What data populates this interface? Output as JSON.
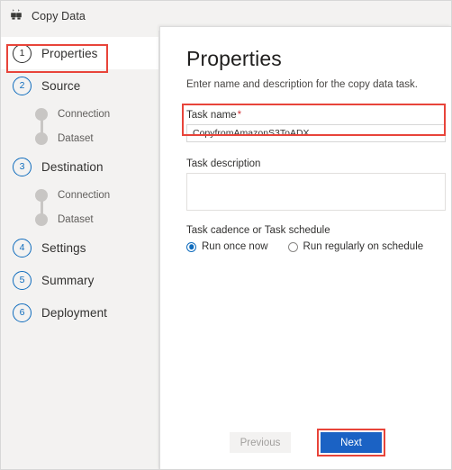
{
  "window": {
    "title": "Copy Data",
    "icon": "copy-data-icon"
  },
  "colors": {
    "accent_blue": "#0f6cbd",
    "primary_button": "#1b62c4",
    "annotation_red": "#e8443a",
    "required_red": "#d13438",
    "rail_background": "#f3f2f1",
    "active_step": "#2b2b2b"
  },
  "sidebar": {
    "steps": [
      {
        "number": "1",
        "label": "Properties",
        "active": true,
        "substeps": []
      },
      {
        "number": "2",
        "label": "Source",
        "active": false,
        "substeps": [
          "Connection",
          "Dataset"
        ]
      },
      {
        "number": "3",
        "label": "Destination",
        "active": false,
        "substeps": [
          "Connection",
          "Dataset"
        ]
      },
      {
        "number": "4",
        "label": "Settings",
        "active": false,
        "substeps": []
      },
      {
        "number": "5",
        "label": "Summary",
        "active": false,
        "substeps": []
      },
      {
        "number": "6",
        "label": "Deployment",
        "active": false,
        "substeps": []
      }
    ]
  },
  "main": {
    "title": "Properties",
    "subtitle": "Enter name and description for the copy data task.",
    "task_name": {
      "label": "Task name",
      "required_marker": "*",
      "value": "CopyfromAmazonS3ToADX"
    },
    "task_description": {
      "label": "Task description",
      "value": ""
    },
    "cadence": {
      "label": "Task cadence or Task schedule",
      "options": [
        {
          "label": "Run once now",
          "selected": true
        },
        {
          "label": "Run regularly on schedule",
          "selected": false
        }
      ]
    }
  },
  "footer": {
    "previous_label": "Previous",
    "next_label": "Next"
  }
}
